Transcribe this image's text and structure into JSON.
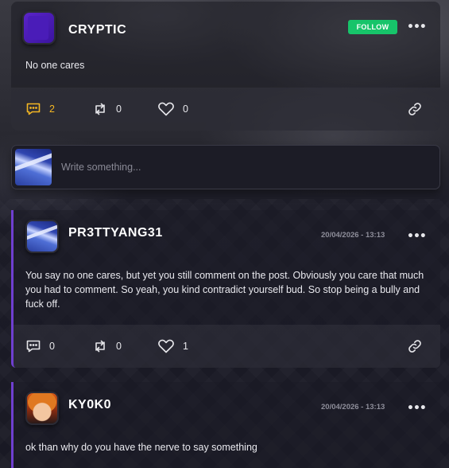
{
  "post": {
    "username": "CRYPTIC",
    "follow_label": "FOLLOW",
    "more_label": "•••",
    "body": "No one cares",
    "actions": {
      "comments": "2",
      "reposts": "0",
      "likes": "0"
    }
  },
  "comment_box": {
    "placeholder": "Write something..."
  },
  "replies": [
    {
      "username": "PR3TTYANG31",
      "timestamp": "20/04/2026 - 13:13",
      "more_label": "•••",
      "body": "You say no one cares, but yet you still comment on the post. Obviously you care that much you had to comment. So yeah, you kind contradict yourself bud. So stop being a bully and fuck off.",
      "actions": {
        "comments": "0",
        "reposts": "0",
        "likes": "1"
      }
    },
    {
      "username": "KY0K0",
      "timestamp": "20/04/2026 - 13:13",
      "more_label": "•••",
      "body": "ok than why do you have the nerve to say something"
    }
  ],
  "colors": {
    "follow_green": "#17c46a",
    "active_comment": "#f3b623",
    "reply_accent": "#6f3fd0"
  },
  "icons": [
    "comment-icon",
    "repost-icon",
    "heart-icon",
    "link-icon",
    "more-icon"
  ]
}
